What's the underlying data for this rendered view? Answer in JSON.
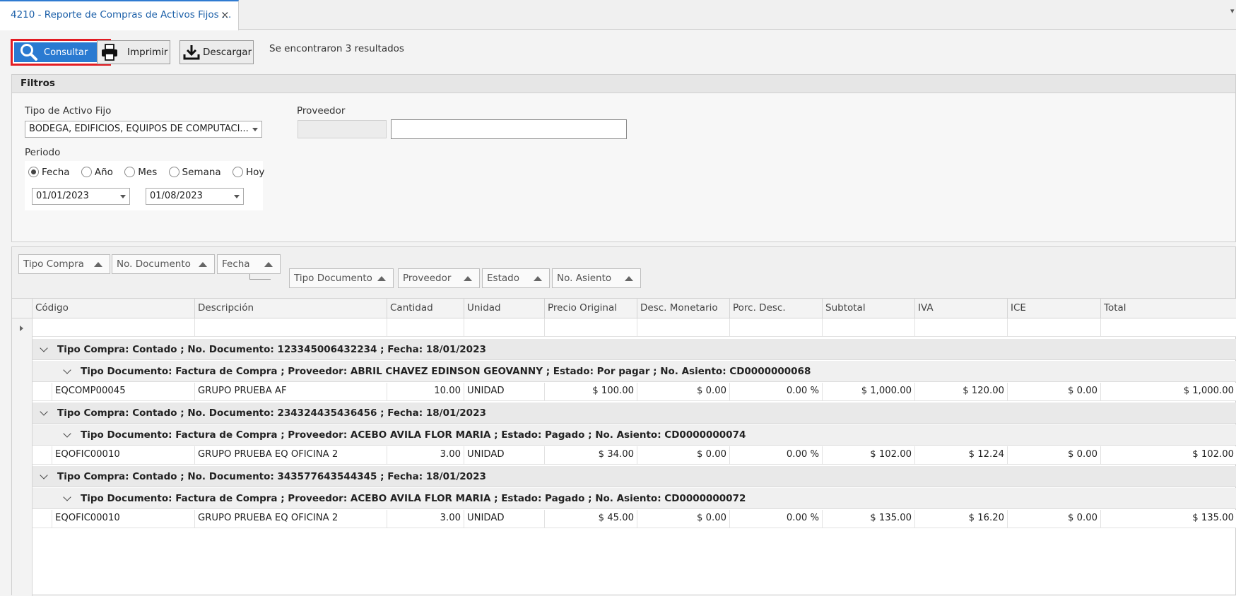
{
  "tab": {
    "title": "4210 - Reporte de Compras de Activos Fijos ::.",
    "close": "×"
  },
  "toolbar": {
    "consultar": "Consultar",
    "imprimir": "Imprimir",
    "descargar": "Descargar",
    "results": "Se encontraron 3 resultados"
  },
  "filters": {
    "title": "Filtros",
    "tipo_label": "Tipo de Activo Fijo",
    "tipo_value": "BODEGA, EDIFICIOS, EQUIPOS DE COMPUTACI...",
    "proveedor_label": "Proveedor",
    "proveedor_code": "",
    "proveedor_name": "",
    "periodo_label": "Periodo",
    "radios": [
      "Fecha",
      "Año",
      "Mes",
      "Semana",
      "Hoy"
    ],
    "selected_radio": "Fecha",
    "date_from": "01/01/2023",
    "date_to": "01/08/2023"
  },
  "group_chips": [
    "Tipo Compra",
    "No. Documento",
    "Fecha",
    "Tipo Documento",
    "Proveedor",
    "Estado",
    "No. Asiento"
  ],
  "columns": [
    "Código",
    "Descripción",
    "Cantidad",
    "Unidad",
    "Precio Original",
    "Desc. Monetario",
    "Porc. Desc.",
    "Subtotal",
    "IVA",
    "ICE",
    "Total"
  ],
  "groups": [
    {
      "header": "Tipo Compra: Contado ; No. Documento: 123345006432234 ; Fecha: 18/01/2023",
      "sub": "Tipo Documento: Factura de Compra ; Proveedor: ABRIL CHAVEZ EDINSON GEOVANNY ; Estado: Por pagar ; No. Asiento: CD0000000068",
      "row": [
        "EQCOMP00045",
        "GRUPO PRUEBA AF",
        "10.00",
        "UNIDAD",
        "$ 100.00",
        "$ 0.00",
        "0.00 %",
        "$ 1,000.00",
        "$ 120.00",
        "$ 0.00",
        "$ 1,000.00"
      ]
    },
    {
      "header": "Tipo Compra: Contado ; No. Documento: 234324435436456 ; Fecha: 18/01/2023",
      "sub": "Tipo Documento: Factura de Compra ; Proveedor: ACEBO AVILA FLOR MARIA ; Estado: Pagado ; No. Asiento: CD0000000074",
      "row": [
        "EQOFIC00010",
        "GRUPO PRUEBA EQ OFICINA 2",
        "3.00",
        "UNIDAD",
        "$ 34.00",
        "$ 0.00",
        "0.00 %",
        "$ 102.00",
        "$ 12.24",
        "$ 0.00",
        "$ 102.00"
      ]
    },
    {
      "header": "Tipo Compra: Contado ; No. Documento: 343577643544345 ; Fecha: 18/01/2023",
      "sub": "Tipo Documento: Factura de Compra ; Proveedor: ACEBO AVILA FLOR MARIA ; Estado: Pagado ; No. Asiento: CD0000000072",
      "row": [
        "EQOFIC00010",
        "GRUPO PRUEBA EQ OFICINA 2",
        "3.00",
        "UNIDAD",
        "$ 45.00",
        "$ 0.00",
        "0.00 %",
        "$ 135.00",
        "$ 16.20",
        "$ 0.00",
        "$ 135.00"
      ]
    }
  ],
  "colors": {
    "accent": "#2a7ad1",
    "highlight": "#e21c23"
  }
}
